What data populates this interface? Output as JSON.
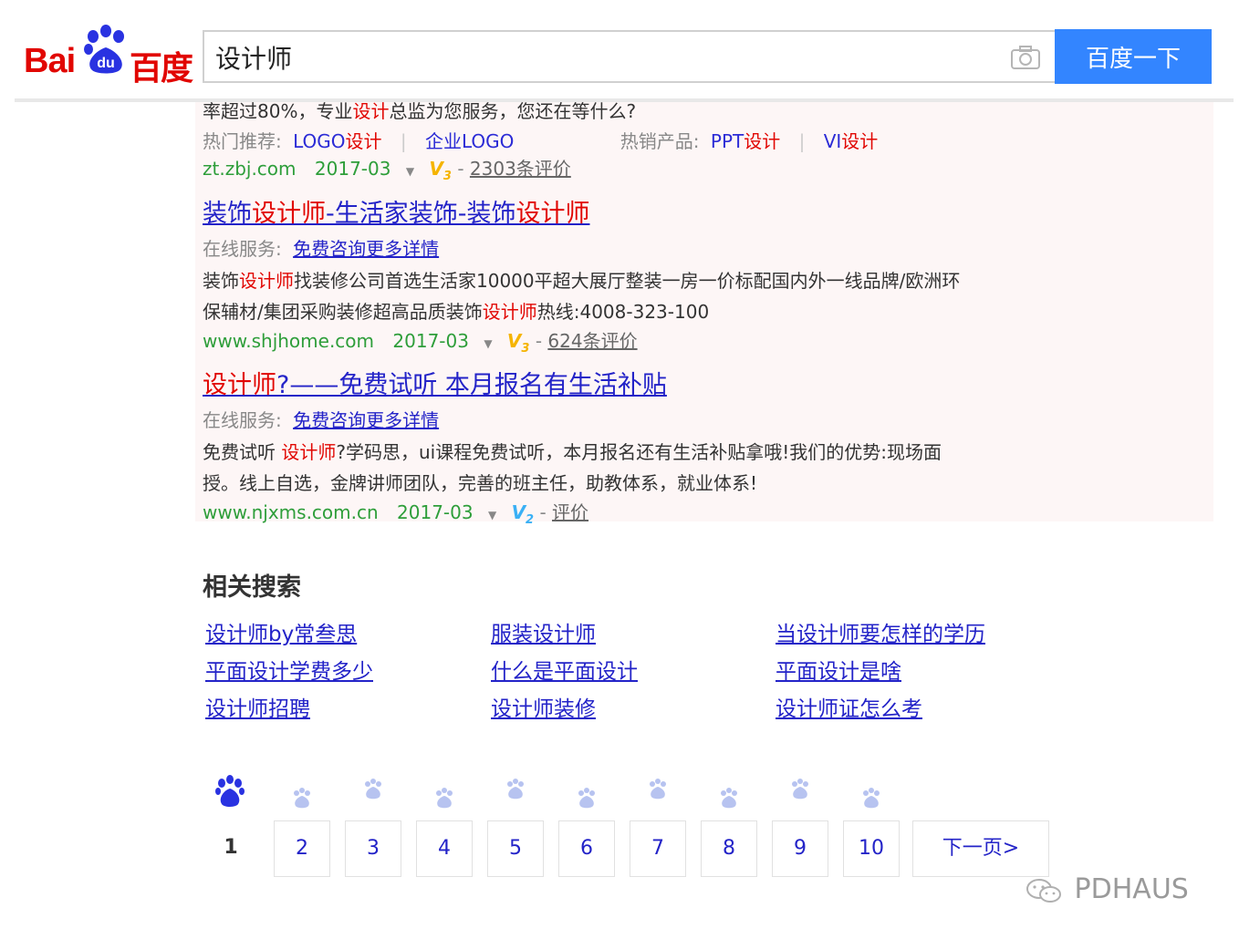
{
  "header": {
    "logo_text_latin": "Bai",
    "logo_text_paw": "du",
    "logo_text_cn": "百度",
    "search_value": "设计师",
    "search_button": "百度一下",
    "camera_icon": "camera-icon"
  },
  "results": {
    "r0": {
      "desc_pre": "率超过80%，专业",
      "desc_hl": "设计",
      "desc_post": "总监为您服务，您还在等什么?",
      "hot_label": "热门推荐:",
      "hot1_a": "LOGO",
      "hot1_b": "设计",
      "hot2": "企业LOGO",
      "sell_label": "热销产品:",
      "sell1_a": "PPT",
      "sell1_b": "设计",
      "sell2_a": "VI",
      "sell2_b": "设计",
      "url": "zt.zbj.com",
      "date": "2017-03",
      "v": "V",
      "v_num": "3",
      "eval": "2303条评价"
    },
    "r1": {
      "title_a": "装饰",
      "title_b": "设计师",
      "title_c": "-生活家装饰-装饰",
      "title_d": "设计师",
      "service_label": "在线服务:",
      "service_link": "免费咨询更多详情",
      "desc1_a": "装饰",
      "desc1_b": "设计师",
      "desc1_c": "找装修公司首选生活家10000平超大展厅整装一房一价标配国内外一线品牌/欧洲环",
      "desc2_a": "保辅材/集团采购装修超高品质装饰",
      "desc2_b": "设计师",
      "desc2_c": "热线:4008-323-100",
      "url": "www.shjhome.com",
      "date": "2017-03",
      "v": "V",
      "v_num": "3",
      "eval": "624条评价"
    },
    "r2": {
      "title_a": "设计师",
      "title_b": "?——免费试听 本月报名有生活补贴",
      "service_label": "在线服务:",
      "service_link": "免费咨询更多详情",
      "desc1_a": "免费试听 ",
      "desc1_b": "设计师",
      "desc1_c": "?学码思，ui课程免费试听，本月报名还有生活补贴拿哦!我们的优势:现场面",
      "desc2": "授。线上自选，金牌讲师团队，完善的班主任，助教体系，就业体系!",
      "url": "www.njxms.com.cn",
      "date": "2017-03",
      "v": "V",
      "v_num": "2",
      "eval": "评价"
    }
  },
  "related": {
    "title": "相关搜索",
    "items": [
      "设计师by常叁思",
      "服装设计师",
      "当设计师要怎样的学历",
      "平面设计学费多少",
      "什么是平面设计",
      "平面设计是啥",
      "设计师招聘",
      "设计师装修",
      "设计师证怎么考"
    ]
  },
  "pager": {
    "current": "1",
    "pages": [
      "2",
      "3",
      "4",
      "5",
      "6",
      "7",
      "8",
      "9",
      "10"
    ],
    "next": "下一页>"
  },
  "watermark": "PDHAUS",
  "colors": {
    "brand_red": "#e10602",
    "brand_blue": "#3385ff",
    "link": "#2323c8",
    "url_green": "#2e9e3a",
    "ad_bg": "#fdf6f6"
  }
}
